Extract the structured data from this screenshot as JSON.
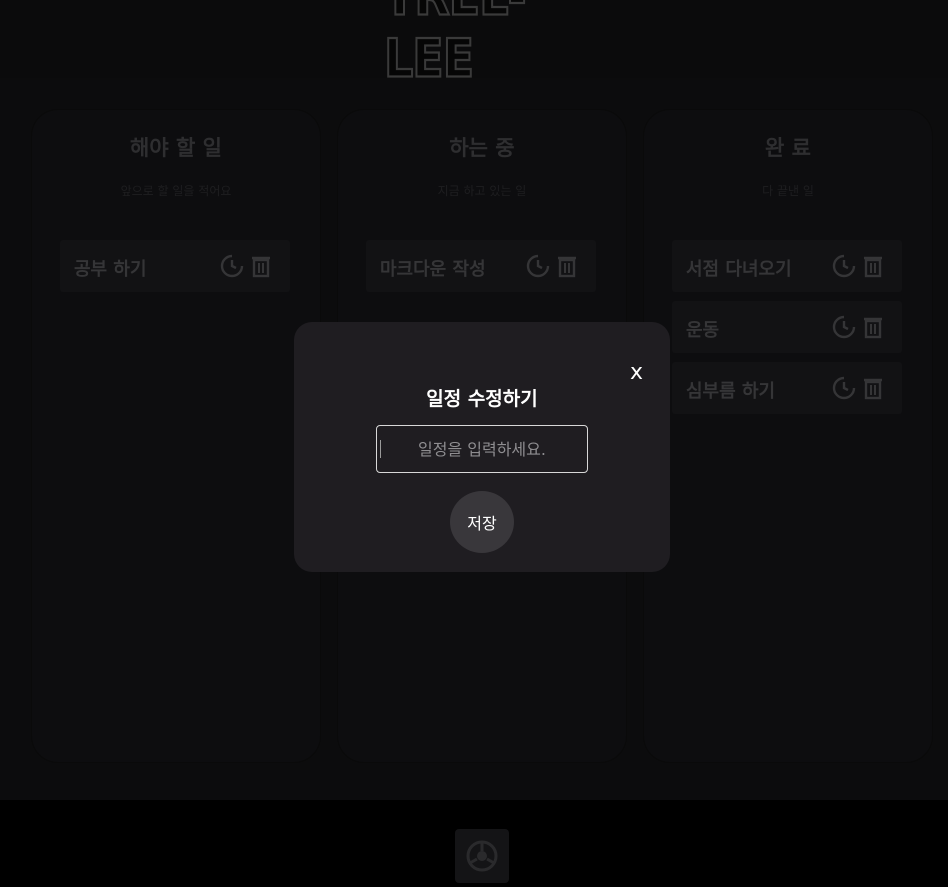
{
  "app": {
    "logo_text": "TREL-LEE"
  },
  "columns": [
    {
      "title": "해야 할 일",
      "subtitle": "앞으로 할 일을 적어요",
      "cards": [
        {
          "label": "공부 하기"
        }
      ]
    },
    {
      "title": "하는 중",
      "subtitle": "지금 하고 있는 일",
      "cards": [
        {
          "label": "마크다운 작성"
        }
      ]
    },
    {
      "title": "완 료",
      "subtitle": "다 끝낸 일",
      "cards": [
        {
          "label": "서점 다녀오기"
        },
        {
          "label": "운동"
        },
        {
          "label": "심부름 하기"
        }
      ]
    }
  ],
  "icons": {
    "restore": "restore-icon",
    "trash": "trash-icon",
    "footer": "settings-icon"
  },
  "modal": {
    "close_label": "x",
    "title": "일정 수정하기",
    "input_value": "",
    "input_placeholder": "일정을 입력하세요.",
    "save_label": "저장"
  },
  "colors": {
    "modal_bg": "#1f1d21",
    "save_button_bg": "#39373b",
    "page_bg": "#0c0c0d"
  }
}
